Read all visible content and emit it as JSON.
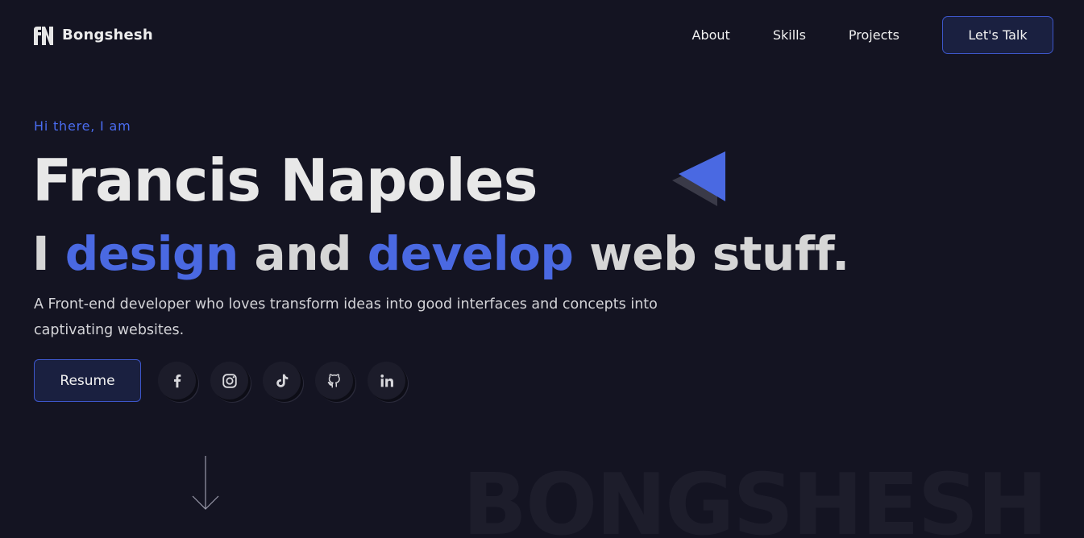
{
  "nav": {
    "brand_name": "Bongshesh",
    "links": [
      "About",
      "Skills",
      "Projects"
    ],
    "cta_label": "Let's Talk"
  },
  "hero": {
    "greeting": "Hi there, I am",
    "name": "Francis Napoles",
    "tagline": {
      "part1": "I ",
      "accent1": "design",
      "part2": " and ",
      "accent2": "develop",
      "part3": " web stuff."
    },
    "bio": "A Front-end developer who loves transform ideas into good interfaces and concepts into captivating websites.",
    "resume_label": "Resume"
  },
  "socials": [
    {
      "name": "facebook-icon"
    },
    {
      "name": "instagram-icon"
    },
    {
      "name": "tiktok-icon"
    },
    {
      "name": "github-icon"
    },
    {
      "name": "linkedin-icon"
    }
  ],
  "watermark": "BONGSHESH",
  "colors": {
    "background": "#141422",
    "accent": "#4a69e2",
    "button_border": "#3d56c9",
    "button_bg": "#1a2040"
  }
}
